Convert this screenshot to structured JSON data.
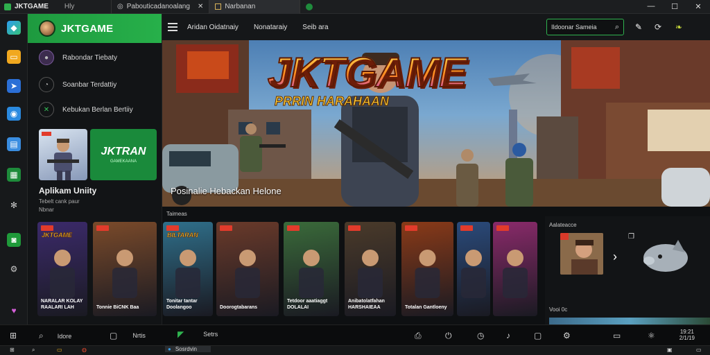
{
  "titlebar": {
    "app_name": "JKTGAME",
    "app_sub": "Hly",
    "tabs": [
      {
        "label": "Pabouticadanoalang"
      },
      {
        "label": "Narbanan"
      }
    ],
    "controls": {
      "minimize": "—",
      "maximize": "☐",
      "close": "✕"
    }
  },
  "sidebar": {
    "brand": "JKTGAME",
    "items": [
      {
        "label": "Rabondar Tiebaty"
      },
      {
        "label": "Soanbar Terdattiy"
      },
      {
        "label": "Kebukan Berlan Bertiiy"
      }
    ],
    "promo_label": "JKTRAN",
    "promo_sub": "GAMEKAANA",
    "title": "Aplikam Uniity",
    "subtitle": "Tebelt cank paur",
    "subtitle2": "Nbnar"
  },
  "appbar": {
    "tabs": [
      {
        "label": "Aridan Oidatnaiy"
      },
      {
        "label": "Nonataraiy"
      },
      {
        "label": "Seib ara"
      }
    ],
    "search_placeholder": "Ildoonar Sameia"
  },
  "hero": {
    "title": "JKTGAME",
    "subtitle": "PRRIN HARAHAAN",
    "caption": "Posinalie Hebackan Helone"
  },
  "sections": {
    "games_label": "Taimeas",
    "right_label": "Aalateacce",
    "right_footer": "Vooi 0c"
  },
  "cards": [
    {
      "top": "JKTGAME",
      "title": "NARALAR KOLAY RAALARI LAH",
      "bg": "#3b2a6a"
    },
    {
      "top": "",
      "title": "Tonnie BiCNK Baa",
      "bg": "#7a4a2a"
    },
    {
      "top": "BILTARAN",
      "title": "Tonitar tantar Doolangoo",
      "bg": "#2f6f8a"
    },
    {
      "top": "",
      "title": "Doorogtabarans",
      "bg": "#6a3a2a"
    },
    {
      "top": "",
      "title": "Tetdoor aaatiaggt DOLALAI",
      "bg": "#3a6a3a"
    },
    {
      "top": "",
      "title": "Anibatolatfahan HARSHAIEAA",
      "bg": "#4a3a2a"
    },
    {
      "top": "",
      "title": "Totalan Gantloeny",
      "bg": "#8a3a18"
    },
    {
      "top": "",
      "title": "",
      "bg": "#2a4a7a"
    },
    {
      "top": "",
      "title": "",
      "bg": "#8a2a6a"
    }
  ],
  "taskbar": {
    "items": [
      {
        "label": "Idore"
      },
      {
        "label": "Nrtis"
      },
      {
        "label": "Setrs"
      },
      {
        "label": "Sosrdvin"
      }
    ],
    "clock_time": "19:21",
    "clock_date": "2/1/19"
  },
  "colors": {
    "accent": "#27b04a",
    "bg": "#0e1012"
  }
}
